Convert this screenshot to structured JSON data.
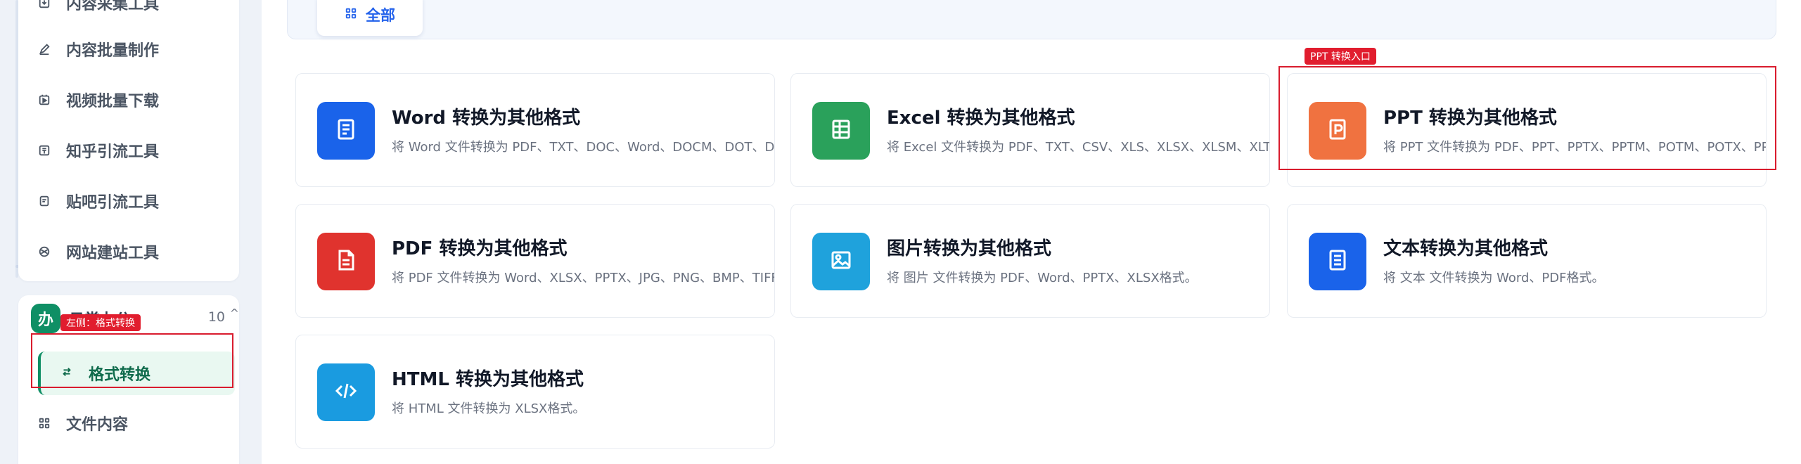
{
  "sidebar": {
    "group_a_items": [
      {
        "label": "内容采集工具",
        "icon": "download-box-icon"
      },
      {
        "label": "内容批量制作",
        "icon": "pencil-icon"
      },
      {
        "label": "视频批量下载",
        "icon": "video-icon"
      },
      {
        "label": "知乎引流工具",
        "icon": "zhihu-icon"
      },
      {
        "label": "贴吧引流工具",
        "icon": "document-icon"
      },
      {
        "label": "网站建站工具",
        "icon": "globe-icon"
      }
    ],
    "group_b": {
      "badge": "办",
      "title": "日常办公",
      "count": "10",
      "caret": "^",
      "active_item": {
        "label": "格式转换",
        "icon": "swap-icon"
      },
      "items": [
        {
          "label": "文件内容",
          "icon": "grid-icon"
        }
      ]
    }
  },
  "annotations": {
    "left_tag": "左侧：格式转换",
    "ppt_tag": "PPT 转换入口"
  },
  "filter": {
    "all_label": "全部"
  },
  "cards": [
    {
      "title": "Word 转换为其他格式",
      "desc": "将 Word 文件转换为 PDF、TXT、DOC、Word、DOCM、DOT、DOTX格式。",
      "color": "#1a63ea",
      "icon": "document-lines-icon"
    },
    {
      "title": "Excel 转换为其他格式",
      "desc": "将 Excel 文件转换为 PDF、TXT、CSV、XLS、XLSX、XLSM、XLTX、XLT格式。",
      "color": "#2aa15b",
      "icon": "table-icon"
    },
    {
      "title": "PPT 转换为其他格式",
      "desc": "将 PPT 文件转换为 PDF、PPT、PPTX、PPTM、POTM、POTX、PPS、PPSX格式。",
      "color": "#f07240",
      "icon": "presentation-icon"
    },
    {
      "title": "PDF 转换为其他格式",
      "desc": "将 PDF 文件转换为 Word、XLSX、PPTX、JPG、PNG、BMP、TIFF格式。",
      "color": "#e0332e",
      "icon": "pdf-file-icon"
    },
    {
      "title": "图片转换为其他格式",
      "desc": "将 图片 文件转换为 PDF、Word、PPTX、XLSX格式。",
      "color": "#1fa2dc",
      "icon": "image-icon"
    },
    {
      "title": "文本转换为其他格式",
      "desc": "将 文本 文件转换为 Word、PDF格式。",
      "color": "#1a63ea",
      "icon": "text-file-icon"
    },
    {
      "title": "HTML 转换为其他格式",
      "desc": "将 HTML 文件转换为 XLSX格式。",
      "color": "#1a9be0",
      "icon": "code-icon"
    }
  ]
}
